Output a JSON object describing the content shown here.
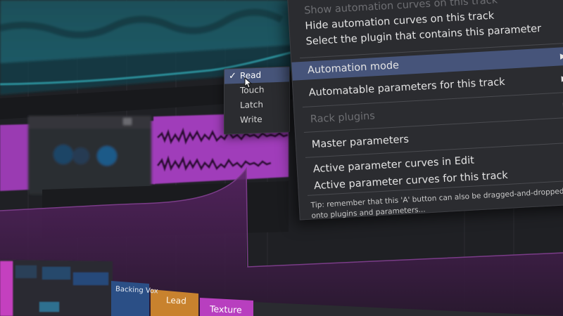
{
  "context_menu": {
    "items": [
      {
        "label": "Show automation curves on this track",
        "disabled": true,
        "submenu": false
      },
      {
        "label": "Hide automation curves on this track",
        "disabled": false,
        "submenu": false
      },
      {
        "label": "Select the plugin that contains this parameter",
        "disabled": false,
        "submenu": false
      },
      {
        "label": "Automation mode",
        "disabled": false,
        "submenu": true,
        "highlighted": true
      },
      {
        "label": "Automatable parameters for this track",
        "disabled": false,
        "submenu": true
      },
      {
        "label": "Rack plugins",
        "disabled": true,
        "submenu": true
      },
      {
        "label": "Master parameters",
        "disabled": false,
        "submenu": true
      },
      {
        "label": "Active parameter curves in Edit",
        "disabled": false,
        "submenu": true
      },
      {
        "label": "Active parameter curves for this track",
        "disabled": false,
        "submenu": true
      }
    ],
    "tip": "Tip: remember that this 'A' button can also be dragged-and-dropped onto plugins and parameters..."
  },
  "automation_submenu": {
    "items": [
      {
        "label": "Read",
        "checked": true
      },
      {
        "label": "Touch",
        "checked": false
      },
      {
        "label": "Latch",
        "checked": false
      },
      {
        "label": "Write",
        "checked": false
      }
    ],
    "check_glyph": "✓"
  },
  "clips": {
    "backing_vox": "Backing Vox",
    "lead": "Lead",
    "texture": "Texture"
  },
  "icons": {
    "submenu_arrow": "right-triangle-icon",
    "pointer": "mouse-pointer-icon"
  },
  "colors": {
    "menu_bg": "#2b2c30",
    "highlight": "#46547a",
    "clip_teal": "#1f5f6b",
    "clip_purple": "#9a3bb2",
    "clip_orange": "#c8822e",
    "clip_magenta": "#b83fbf",
    "background": "#1f2024"
  }
}
